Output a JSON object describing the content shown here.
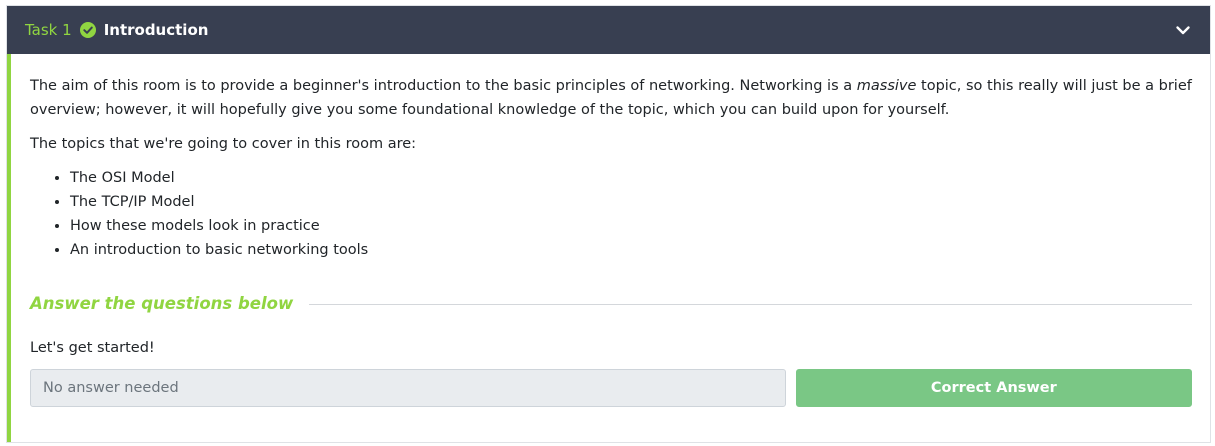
{
  "task": {
    "number_label": "Task 1",
    "title": "Introduction",
    "status_icon": "check-circle-icon",
    "toggle_icon": "chevron-down-icon",
    "colors": {
      "header_bg": "#383f51",
      "accent": "#90d541",
      "button_bg": "#7ac785"
    }
  },
  "body": {
    "intro_part1": "The aim of this room is to provide a beginner's introduction to the basic principles of networking. Networking is a ",
    "intro_emphasis": "massive",
    "intro_part2": " topic, so this really will just be a brief overview; however, it will hopefully give you some foundational knowledge of the topic, which you can build upon for yourself.",
    "topics_intro": "The topics that we're going to cover in this room are:",
    "topics": [
      "The OSI Model",
      "The TCP/IP Model",
      "How these models look in practice",
      "An introduction to basic networking tools"
    ]
  },
  "answers": {
    "heading": "Answer the questions below",
    "question": "Let's get started!",
    "input_placeholder": "No answer needed",
    "button_label": "Correct Answer"
  }
}
